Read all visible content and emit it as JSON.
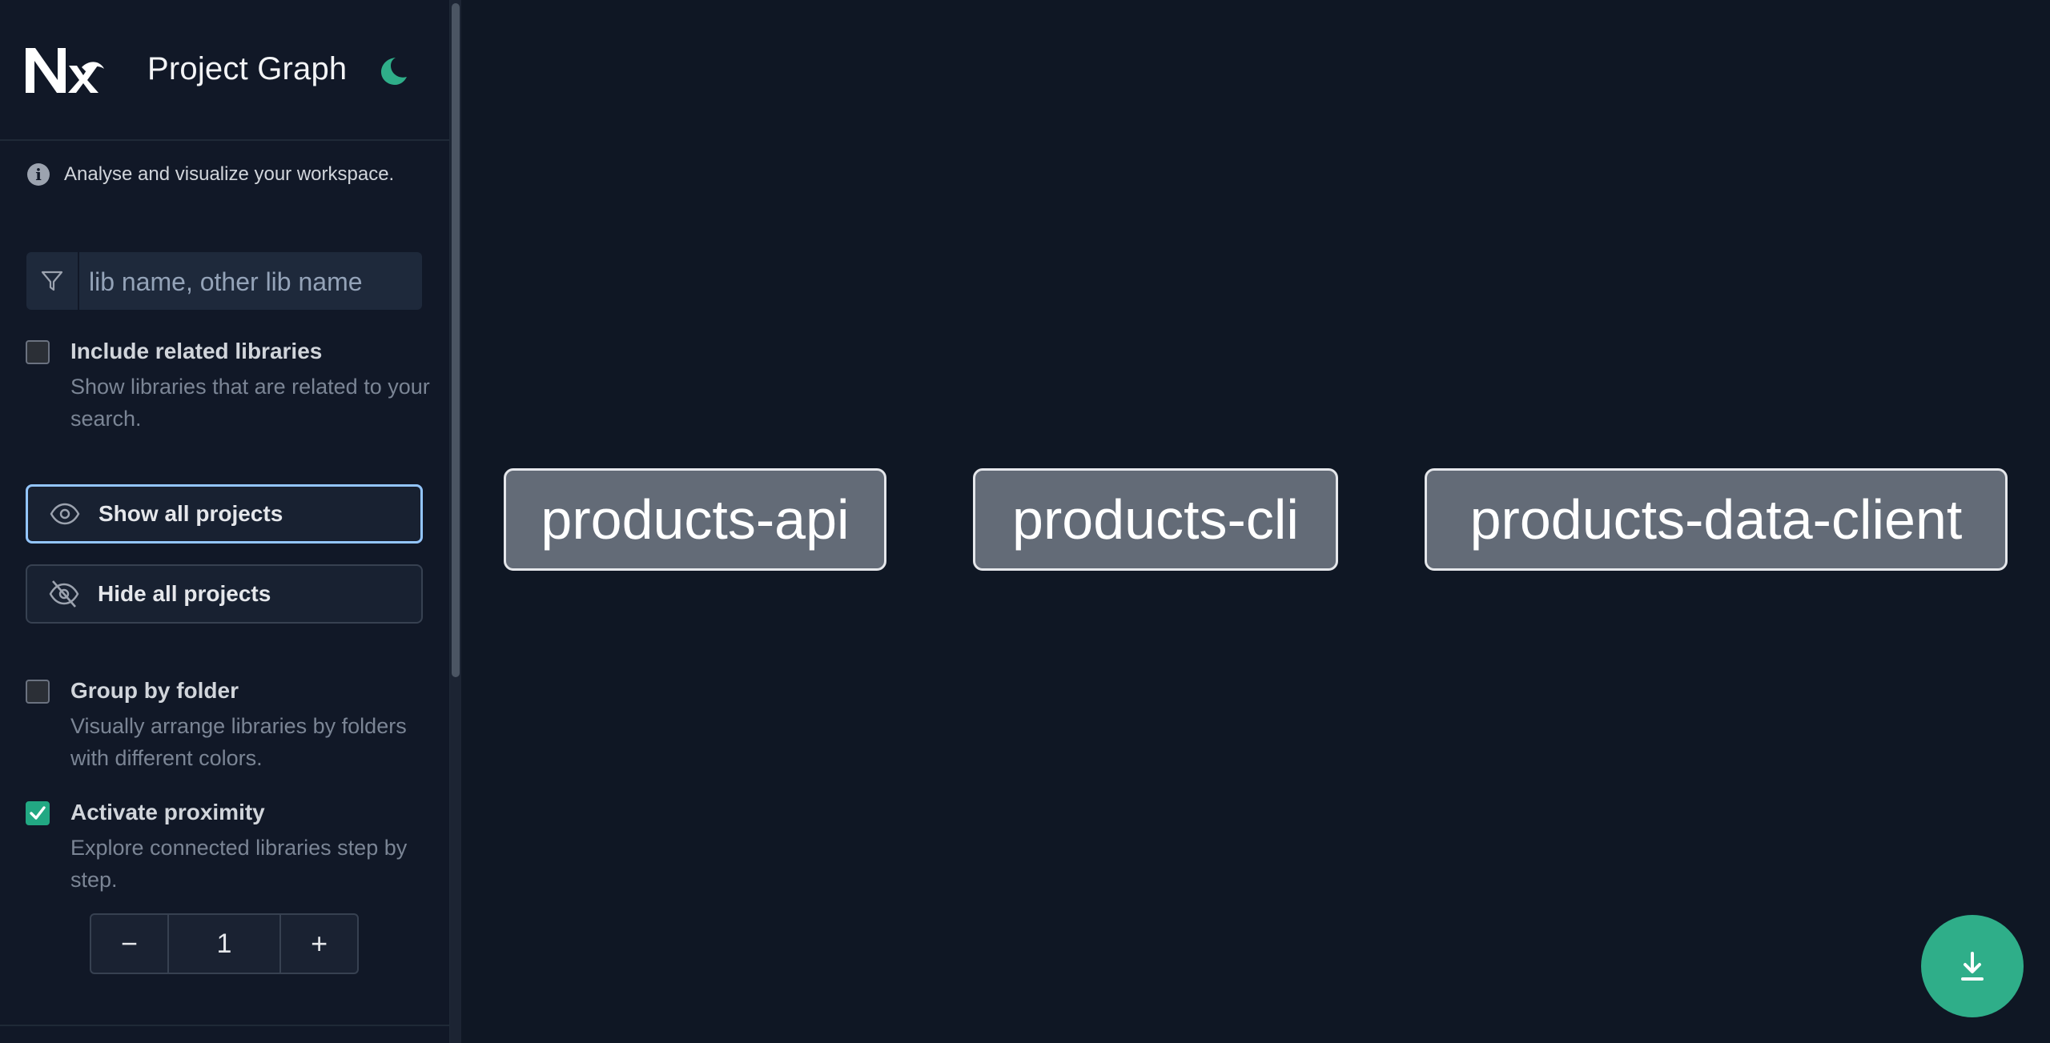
{
  "header": {
    "title": "Project Graph"
  },
  "info": {
    "text": "Analyse and visualize your workspace."
  },
  "search": {
    "placeholder": "lib name, other lib name",
    "value": ""
  },
  "options": {
    "include_related": {
      "label": "Include related libraries",
      "description": "Show libraries that are related to your search.",
      "checked": false
    },
    "group_by_folder": {
      "label": "Group by folder",
      "description": "Visually arrange libraries by folders with different colors.",
      "checked": false
    },
    "activate_proximity": {
      "label": "Activate proximity",
      "description": "Explore connected libraries step by step.",
      "checked": true
    }
  },
  "buttons": {
    "show_all": "Show all projects",
    "hide_all": "Hide all projects"
  },
  "stepper": {
    "decrement": "−",
    "value": "1",
    "increment": "+"
  },
  "graph": {
    "nodes": [
      {
        "label": "products-api"
      },
      {
        "label": "products-cli"
      },
      {
        "label": "products-data-client"
      }
    ]
  },
  "colors": {
    "accent": "#2fae89",
    "background": "#0f1724",
    "sidebar": "#111827",
    "node_fill": "#636b77",
    "node_border": "#e5e7eb",
    "active_button_border": "#93c5fd"
  },
  "icons": {
    "logo": "nx-logo",
    "theme": "moon-icon",
    "info": "info-icon",
    "filter": "filter-icon",
    "show": "eye-icon",
    "hide": "eye-off-icon",
    "download": "download-icon"
  }
}
